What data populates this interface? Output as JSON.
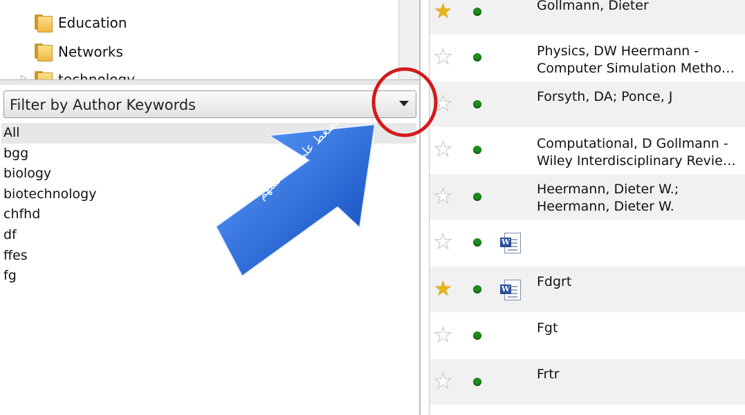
{
  "folder_tree": {
    "items": [
      {
        "label": "Education"
      },
      {
        "label": "Networks"
      },
      {
        "label": "technology"
      }
    ]
  },
  "filter": {
    "selected": "Filter by Author Keywords",
    "keywords": [
      "All",
      "bgg",
      "biology",
      "biotechnology",
      "chfhd",
      "df",
      "ffes",
      "fg"
    ]
  },
  "references": [
    {
      "starred": true,
      "line1": "Gollmann, Dieter",
      "line2": "",
      "has_file": false
    },
    {
      "starred": false,
      "line1": "Physics, DW Heermann -",
      "line2": "Computer Simulation Metho…",
      "has_file": false
    },
    {
      "starred": false,
      "line1": "Forsyth, DA; Ponce, J",
      "line2": "",
      "has_file": false
    },
    {
      "starred": false,
      "line1": "Computational, D Gollmann -",
      "line2": "Wiley Interdisciplinary Revie…",
      "has_file": false
    },
    {
      "starred": false,
      "line1": "Heermann, Dieter W.;",
      "line2": "Heermann, Dieter W.",
      "has_file": false
    },
    {
      "starred": false,
      "line1": "",
      "line2": "",
      "has_file": true
    },
    {
      "starred": true,
      "line1": "Fdgrt",
      "line2": "",
      "has_file": true
    },
    {
      "starred": false,
      "line1": "Fgt",
      "line2": "",
      "has_file": false
    },
    {
      "starred": false,
      "line1": "Frtr",
      "line2": "",
      "has_file": false
    }
  ],
  "annotation": {
    "text": "اضغط على هذا السهم"
  },
  "colors": {
    "arrow_fill": "#1a63d6",
    "circle_stroke": "#d41a1a",
    "star_on": "#e8b21c",
    "read_dot": "#1f8b1f"
  },
  "icons": {
    "folder": "folder-icon",
    "star": "star-icon",
    "status_dot": "read-status-icon",
    "document": "word-document-icon",
    "dropdown": "chevron-down-icon"
  }
}
